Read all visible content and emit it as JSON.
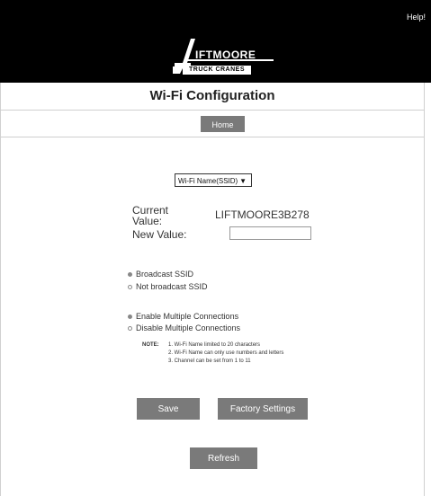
{
  "header": {
    "help_label": "Help!",
    "logo_word": "IFTMOORE",
    "logo_sub": "TRUCK CRANES"
  },
  "page": {
    "title": "Wi-Fi Configuration"
  },
  "nav": {
    "home_label": "Home"
  },
  "form": {
    "select_value": "Wi-Fi Name(SSID)",
    "current_label_line1": "Current",
    "current_label_line2": "Value:",
    "current_value": "LIFTMOORE3B278",
    "new_label": "New Value:",
    "new_value": ""
  },
  "options": {
    "broadcast": "Broadcast SSID",
    "not_broadcast": "Not broadcast SSID",
    "enable_multi": "Enable Multiple Connections",
    "disable_multi": "Disable Multiple Connections"
  },
  "notes": {
    "head": "NOTE:",
    "items": [
      "1. Wi-Fi Name limited to 20 characters",
      "2. Wi-Fi Name can only use numbers and letters",
      "3. Channel can be set from 1 to 11"
    ]
  },
  "buttons": {
    "save": "Save",
    "factory": "Factory Settings",
    "refresh": "Refresh"
  },
  "colors": {
    "header_bg": "#000000",
    "button_bg": "#7a7a7a"
  }
}
